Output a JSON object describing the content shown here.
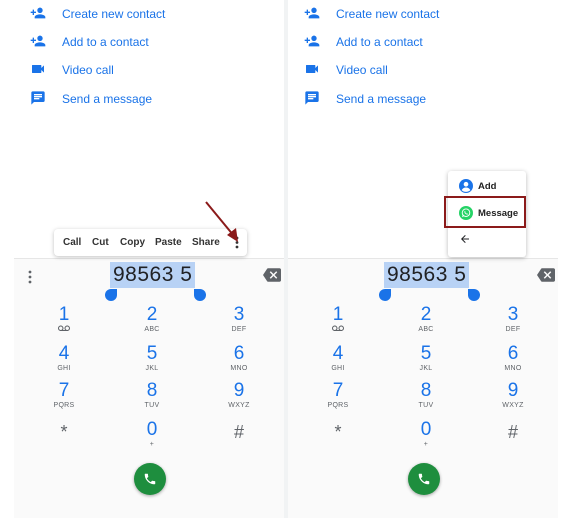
{
  "actions": [
    {
      "label": "Create new contact",
      "icon": "person-add-icon"
    },
    {
      "label": "Add to a contact",
      "icon": "person-add-icon"
    },
    {
      "label": "Video call",
      "icon": "video-camera-icon"
    },
    {
      "label": "Send a message",
      "icon": "message-icon"
    }
  ],
  "dialer": {
    "number": "98563 5",
    "keys": [
      {
        "digit": "1",
        "sub": "voicemail-icon"
      },
      {
        "digit": "2",
        "sub": "ABC"
      },
      {
        "digit": "3",
        "sub": "DEF"
      },
      {
        "digit": "4",
        "sub": "GHI"
      },
      {
        "digit": "5",
        "sub": "JKL"
      },
      {
        "digit": "6",
        "sub": "MNO"
      },
      {
        "digit": "7",
        "sub": "PQRS"
      },
      {
        "digit": "8",
        "sub": "TUV"
      },
      {
        "digit": "9",
        "sub": "WXYZ"
      },
      {
        "digit": "*",
        "sub": ""
      },
      {
        "digit": "0",
        "sub": "+"
      },
      {
        "digit": "#",
        "sub": ""
      }
    ]
  },
  "context_menu": {
    "items": [
      "Call",
      "Cut",
      "Copy",
      "Paste",
      "Share"
    ]
  },
  "overflow_menu": {
    "add": "Add",
    "message": "Message"
  },
  "colors": {
    "accent": "#1a73e8",
    "call_button": "#1e8e3e",
    "highlight_box": "#8b1a1a",
    "arrow": "#8b1a1a",
    "selection": "#b8d2f5"
  }
}
